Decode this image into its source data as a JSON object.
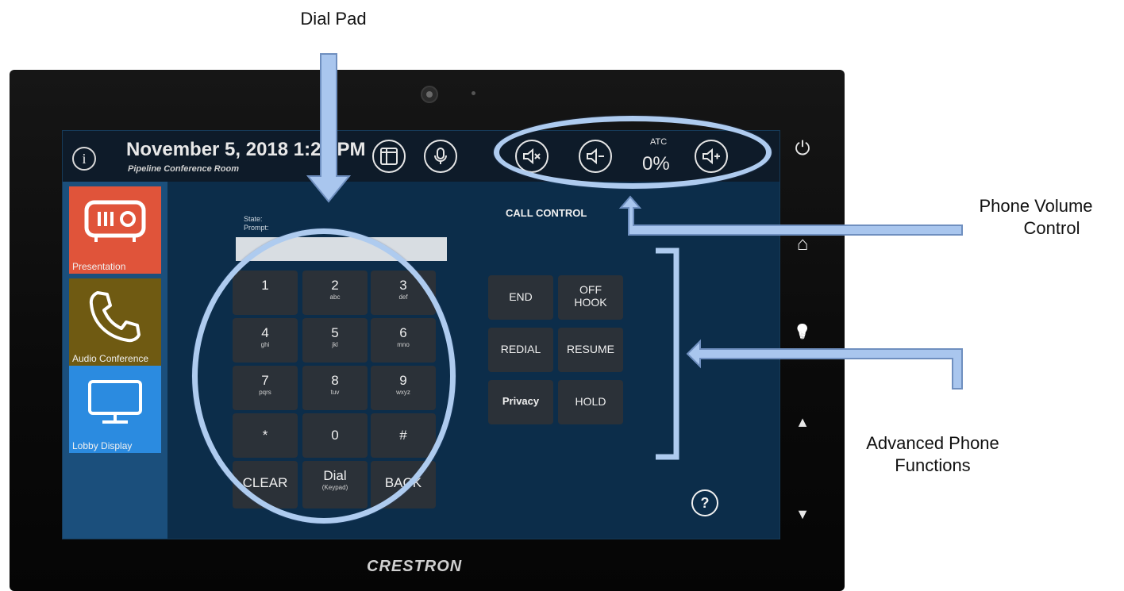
{
  "callouts": {
    "dial_pad": "Dial Pad",
    "phone_volume_line1": "Phone Volume",
    "phone_volume_line2": "Control",
    "advanced_line1": "Advanced Phone",
    "advanced_line2": "Functions"
  },
  "header": {
    "datetime": "November 5, 2018 1:20 PM",
    "room": "Pipeline Conference Room",
    "info_glyph": "i",
    "atc_label": "ATC",
    "atc_value": "0%"
  },
  "sidebar": {
    "items": [
      {
        "label": "Presentation",
        "icon": "projector-icon"
      },
      {
        "label": "Audio Conference",
        "icon": "phone-icon"
      },
      {
        "label": "Lobby Display",
        "icon": "monitor-icon"
      }
    ]
  },
  "dialpad": {
    "state_label": "State:",
    "prompt_label": "Prompt:",
    "display_value": "",
    "keys": [
      {
        "main": "1",
        "sub": ""
      },
      {
        "main": "2",
        "sub": "abc"
      },
      {
        "main": "3",
        "sub": "def"
      },
      {
        "main": "4",
        "sub": "ghi"
      },
      {
        "main": "5",
        "sub": "jkl"
      },
      {
        "main": "6",
        "sub": "mno"
      },
      {
        "main": "7",
        "sub": "pqrs"
      },
      {
        "main": "8",
        "sub": "tuv"
      },
      {
        "main": "9",
        "sub": "wxyz"
      },
      {
        "main": "*",
        "sub": ""
      },
      {
        "main": "0",
        "sub": ""
      },
      {
        "main": "#",
        "sub": ""
      }
    ],
    "clear_label": "CLEAR",
    "dial_label": "Dial",
    "dial_sub": "(Keypad)",
    "back_label": "BACK"
  },
  "call_control": {
    "title": "CALL CONTROL",
    "end": "END",
    "off_hook_line1": "OFF",
    "off_hook_line2": "HOOK",
    "redial": "REDIAL",
    "resume": "RESUME",
    "privacy": "Privacy",
    "hold": "HOLD"
  },
  "help_glyph": "?",
  "bezel": {
    "power": "⏻",
    "home": "⌂",
    "light": "💡",
    "up": "▲",
    "down": "▼"
  },
  "brand": "CRESTRON",
  "colors": {
    "presentation": "#e0543a",
    "audio_conference": "#6f5a12",
    "lobby_display": "#2b8be0",
    "highlight": "#aecbef"
  }
}
